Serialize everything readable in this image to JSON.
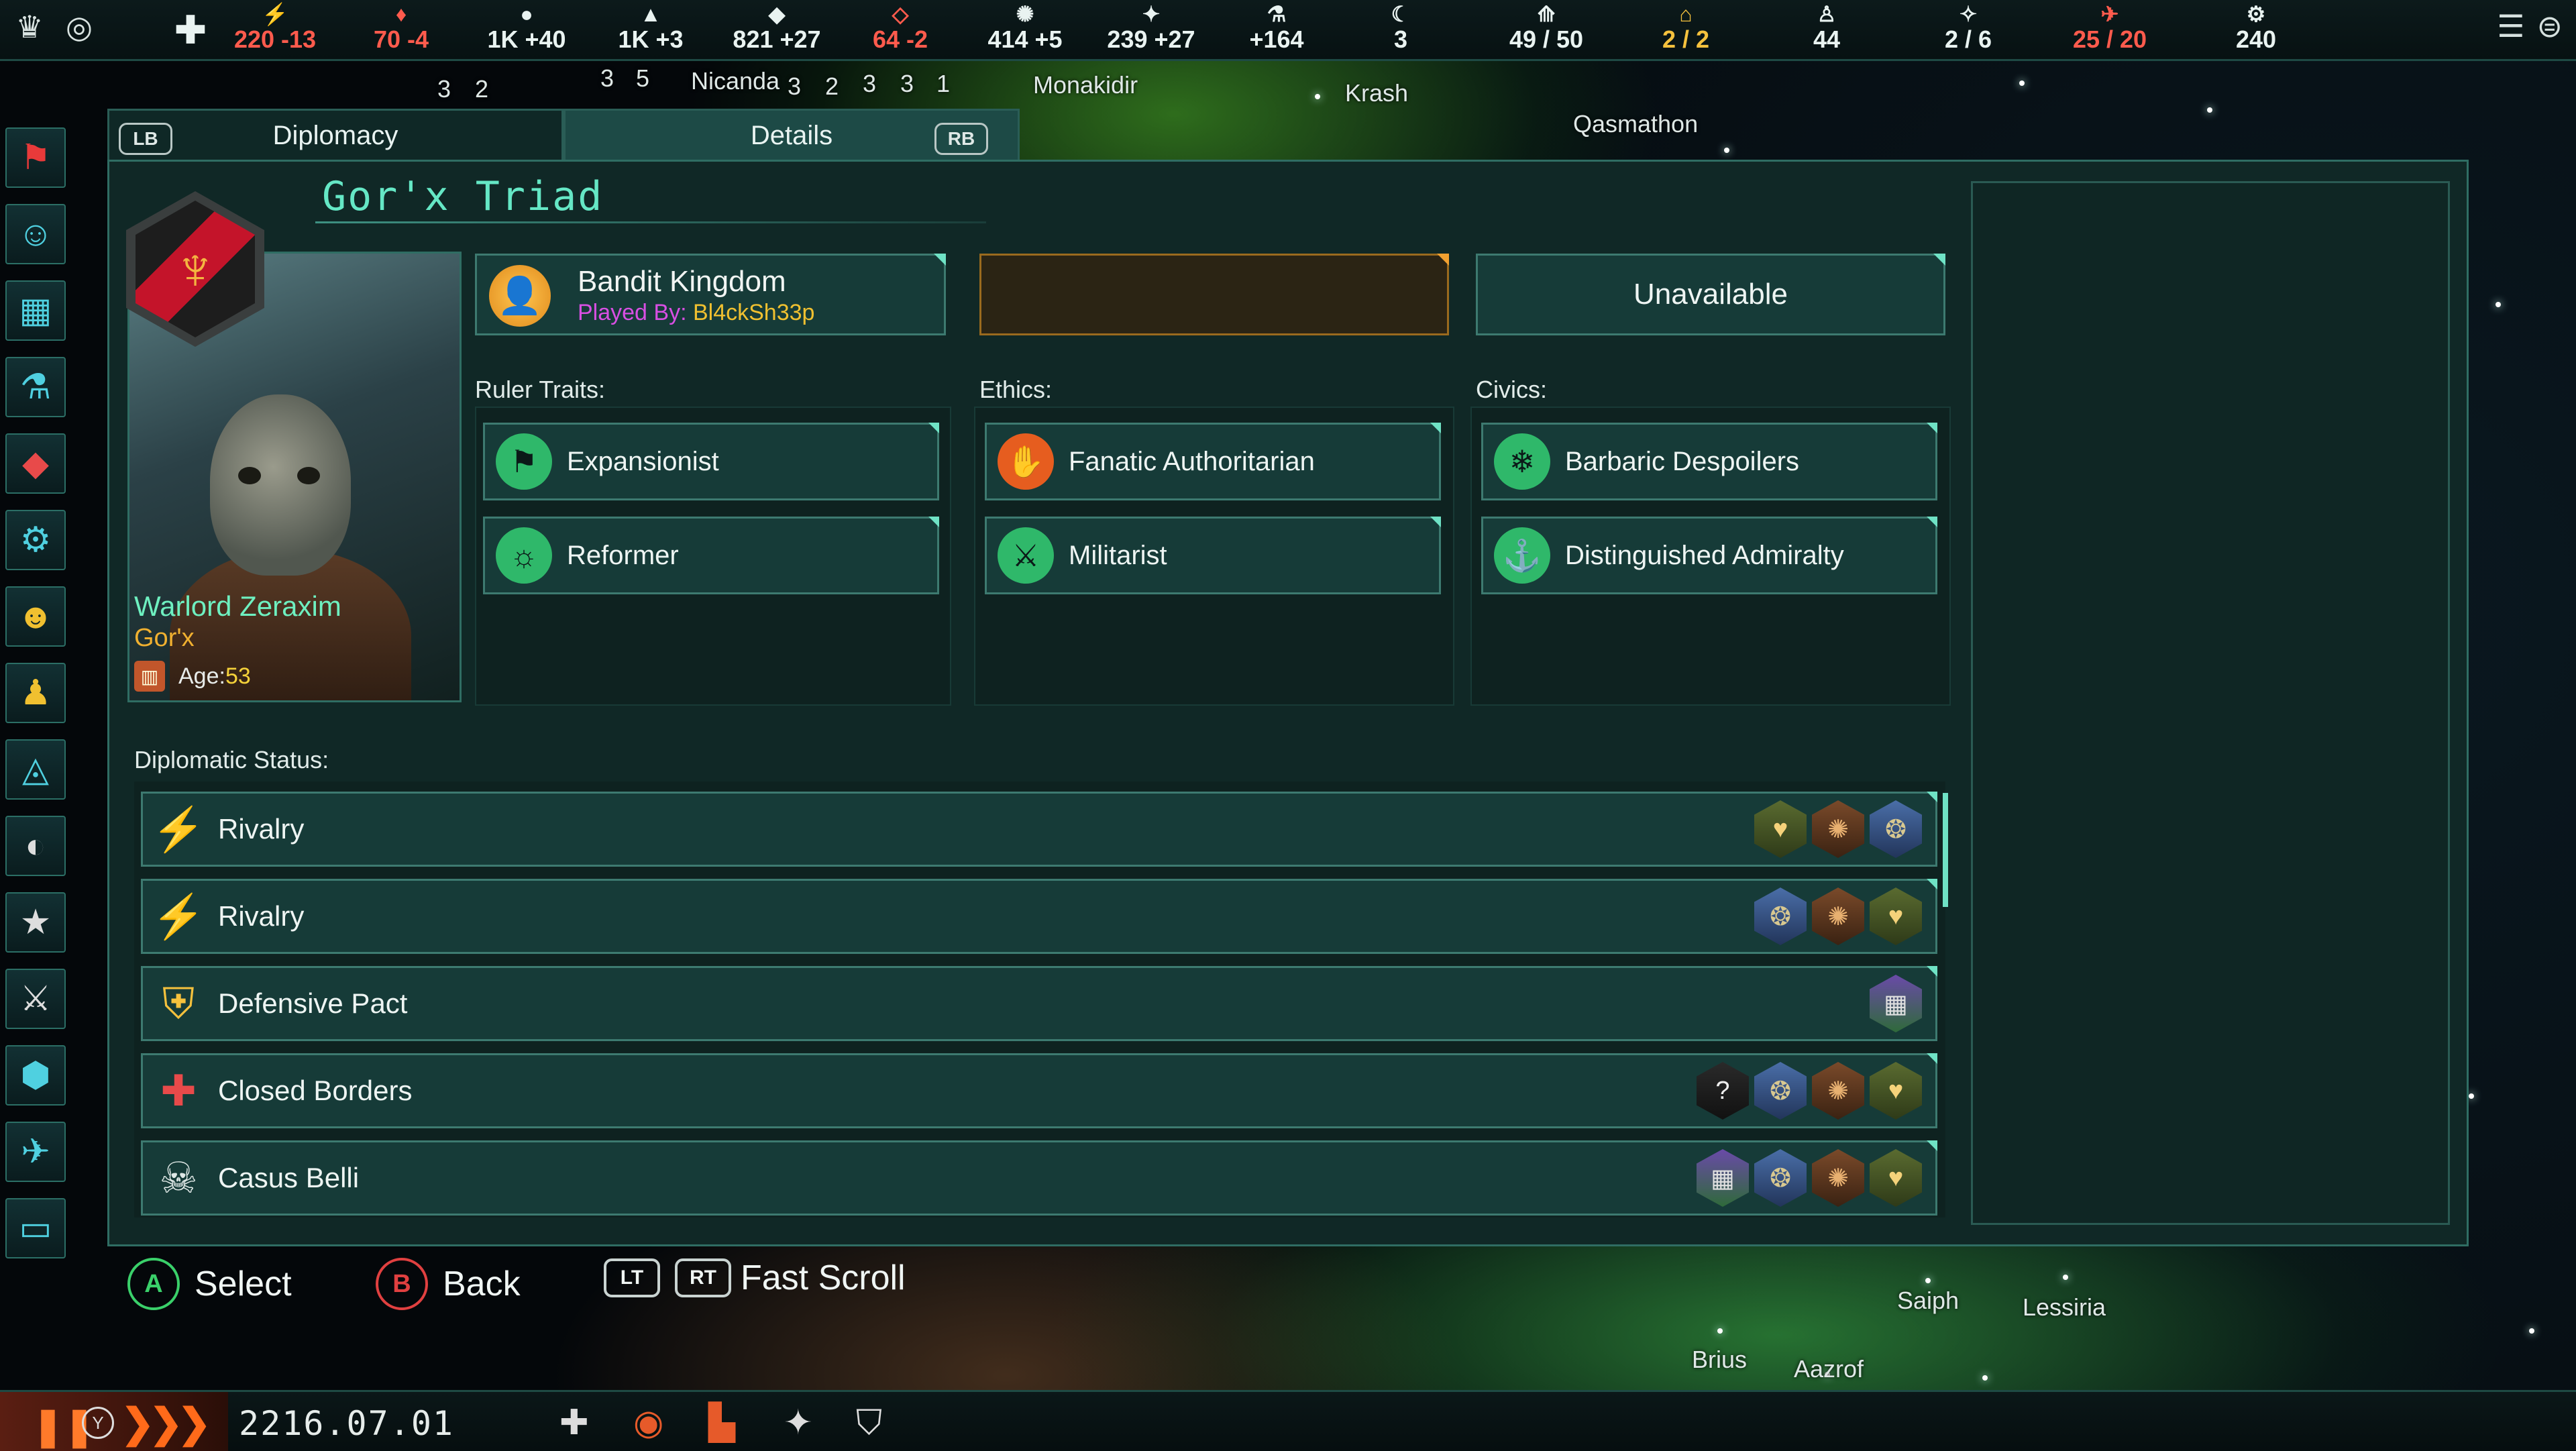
{
  "top_bar": {
    "resources": [
      {
        "icon": "energy-icon",
        "value": "220 -13",
        "state": "neg"
      },
      {
        "icon": "minerals-icon",
        "value": "70 -4",
        "state": "neg"
      },
      {
        "icon": "food-icon",
        "value": "1K +40",
        "state": "normal"
      },
      {
        "icon": "consumer-goods-icon",
        "value": "1K +3",
        "state": "normal"
      },
      {
        "icon": "alloys-icon",
        "value": "821 +27",
        "state": "normal"
      },
      {
        "icon": "strategic-resource-icon",
        "value": "64 -2",
        "state": "neg"
      },
      {
        "icon": "influence-icon",
        "value": "414 +5",
        "state": "normal"
      },
      {
        "icon": "unity-icon",
        "value": "239 +27",
        "state": "normal"
      },
      {
        "icon": "research-icon",
        "value": "+164",
        "state": "normal"
      },
      {
        "icon": "envoys-icon",
        "value": "3",
        "state": "normal"
      },
      {
        "icon": "empire-size-icon",
        "value": "49 / 50",
        "state": "normal"
      },
      {
        "icon": "edicts-icon",
        "value": "2 / 2",
        "state": "gold"
      },
      {
        "icon": "pops-icon",
        "value": "44",
        "state": "normal"
      },
      {
        "icon": "starbase-icon",
        "value": "2 / 6",
        "state": "normal"
      },
      {
        "icon": "fleet-icon",
        "value": "25 / 20",
        "state": "neg"
      },
      {
        "icon": "naval-icon",
        "value": "240",
        "state": "normal"
      }
    ]
  },
  "map_labels": [
    "Nicanda",
    "Monakidir",
    "Krash",
    "Qasmathon",
    "Saiph",
    "Lessiria",
    "Brius",
    "Aazrof"
  ],
  "map_numbers": [
    "3",
    "2",
    "3",
    "5",
    "3",
    "2",
    "3",
    "3",
    "1"
  ],
  "tabs": {
    "left_hint": "LB",
    "diplomacy": "Diplomacy",
    "details": "Details",
    "right_hint": "RB"
  },
  "empire": {
    "name": "Gor'x Triad",
    "ruler_name": "Warlord Zeraxim",
    "species": "Gor'x",
    "age_label": "Age:",
    "age_value": "53",
    "government": "Bandit Kingdom",
    "played_by_label": "Played By:",
    "player_name": "Bl4ckSh33p",
    "availability": "Unavailable"
  },
  "sections": {
    "ruler_traits": "Ruler Traits:",
    "ethics": "Ethics:",
    "civics": "Civics:",
    "diplomatic_status": "Diplomatic Status:"
  },
  "ruler_traits": [
    {
      "label": "Expansionist",
      "icon": "expansionist-icon",
      "color": "#2fb86a"
    },
    {
      "label": "Reformer",
      "icon": "reformer-icon",
      "color": "#2fb86a"
    }
  ],
  "ethics": [
    {
      "label": "Fanatic Authoritarian",
      "icon": "authoritarian-icon",
      "color": "#e65d1f"
    },
    {
      "label": "Militarist",
      "icon": "militarist-icon",
      "color": "#2fb86a"
    }
  ],
  "civics": [
    {
      "label": "Barbaric Despoilers",
      "icon": "despoilers-icon",
      "color": "#2fb86a"
    },
    {
      "label": "Distinguished Admiralty",
      "icon": "admiralty-icon",
      "color": "#2fb86a"
    }
  ],
  "diplomatic_status": [
    {
      "label": "Rivalry",
      "icon": "rivalry-icon",
      "empires": [
        "gold",
        "bronze",
        "blue"
      ]
    },
    {
      "label": "Rivalry",
      "icon": "rivalry-icon",
      "empires": [
        "blue",
        "bronze",
        "gold"
      ]
    },
    {
      "label": "Defensive Pact",
      "icon": "defensive-pact-icon",
      "empires": [
        "purple"
      ]
    },
    {
      "label": "Closed Borders",
      "icon": "closed-borders-icon",
      "empires": [
        "unknown",
        "blue",
        "bronze",
        "gold"
      ]
    },
    {
      "label": "Casus Belli",
      "icon": "casus-belli-icon",
      "empires": [
        "purple",
        "blue",
        "bronze",
        "gold"
      ]
    }
  ],
  "controller_hints": {
    "select_button": "A",
    "select": "Select",
    "back_button": "B",
    "back": "Back",
    "lt": "LT",
    "rt": "RT",
    "fast_scroll": "Fast Scroll"
  },
  "bottom_bar": {
    "y_button": "Y",
    "date": "2216.07.01"
  },
  "colors": {
    "accent": "#65e7c5",
    "panel": "#102826",
    "border": "#3d7a70",
    "negative": "#ff5b4d",
    "gold": "#f0b030",
    "player": "#d84fe3"
  }
}
